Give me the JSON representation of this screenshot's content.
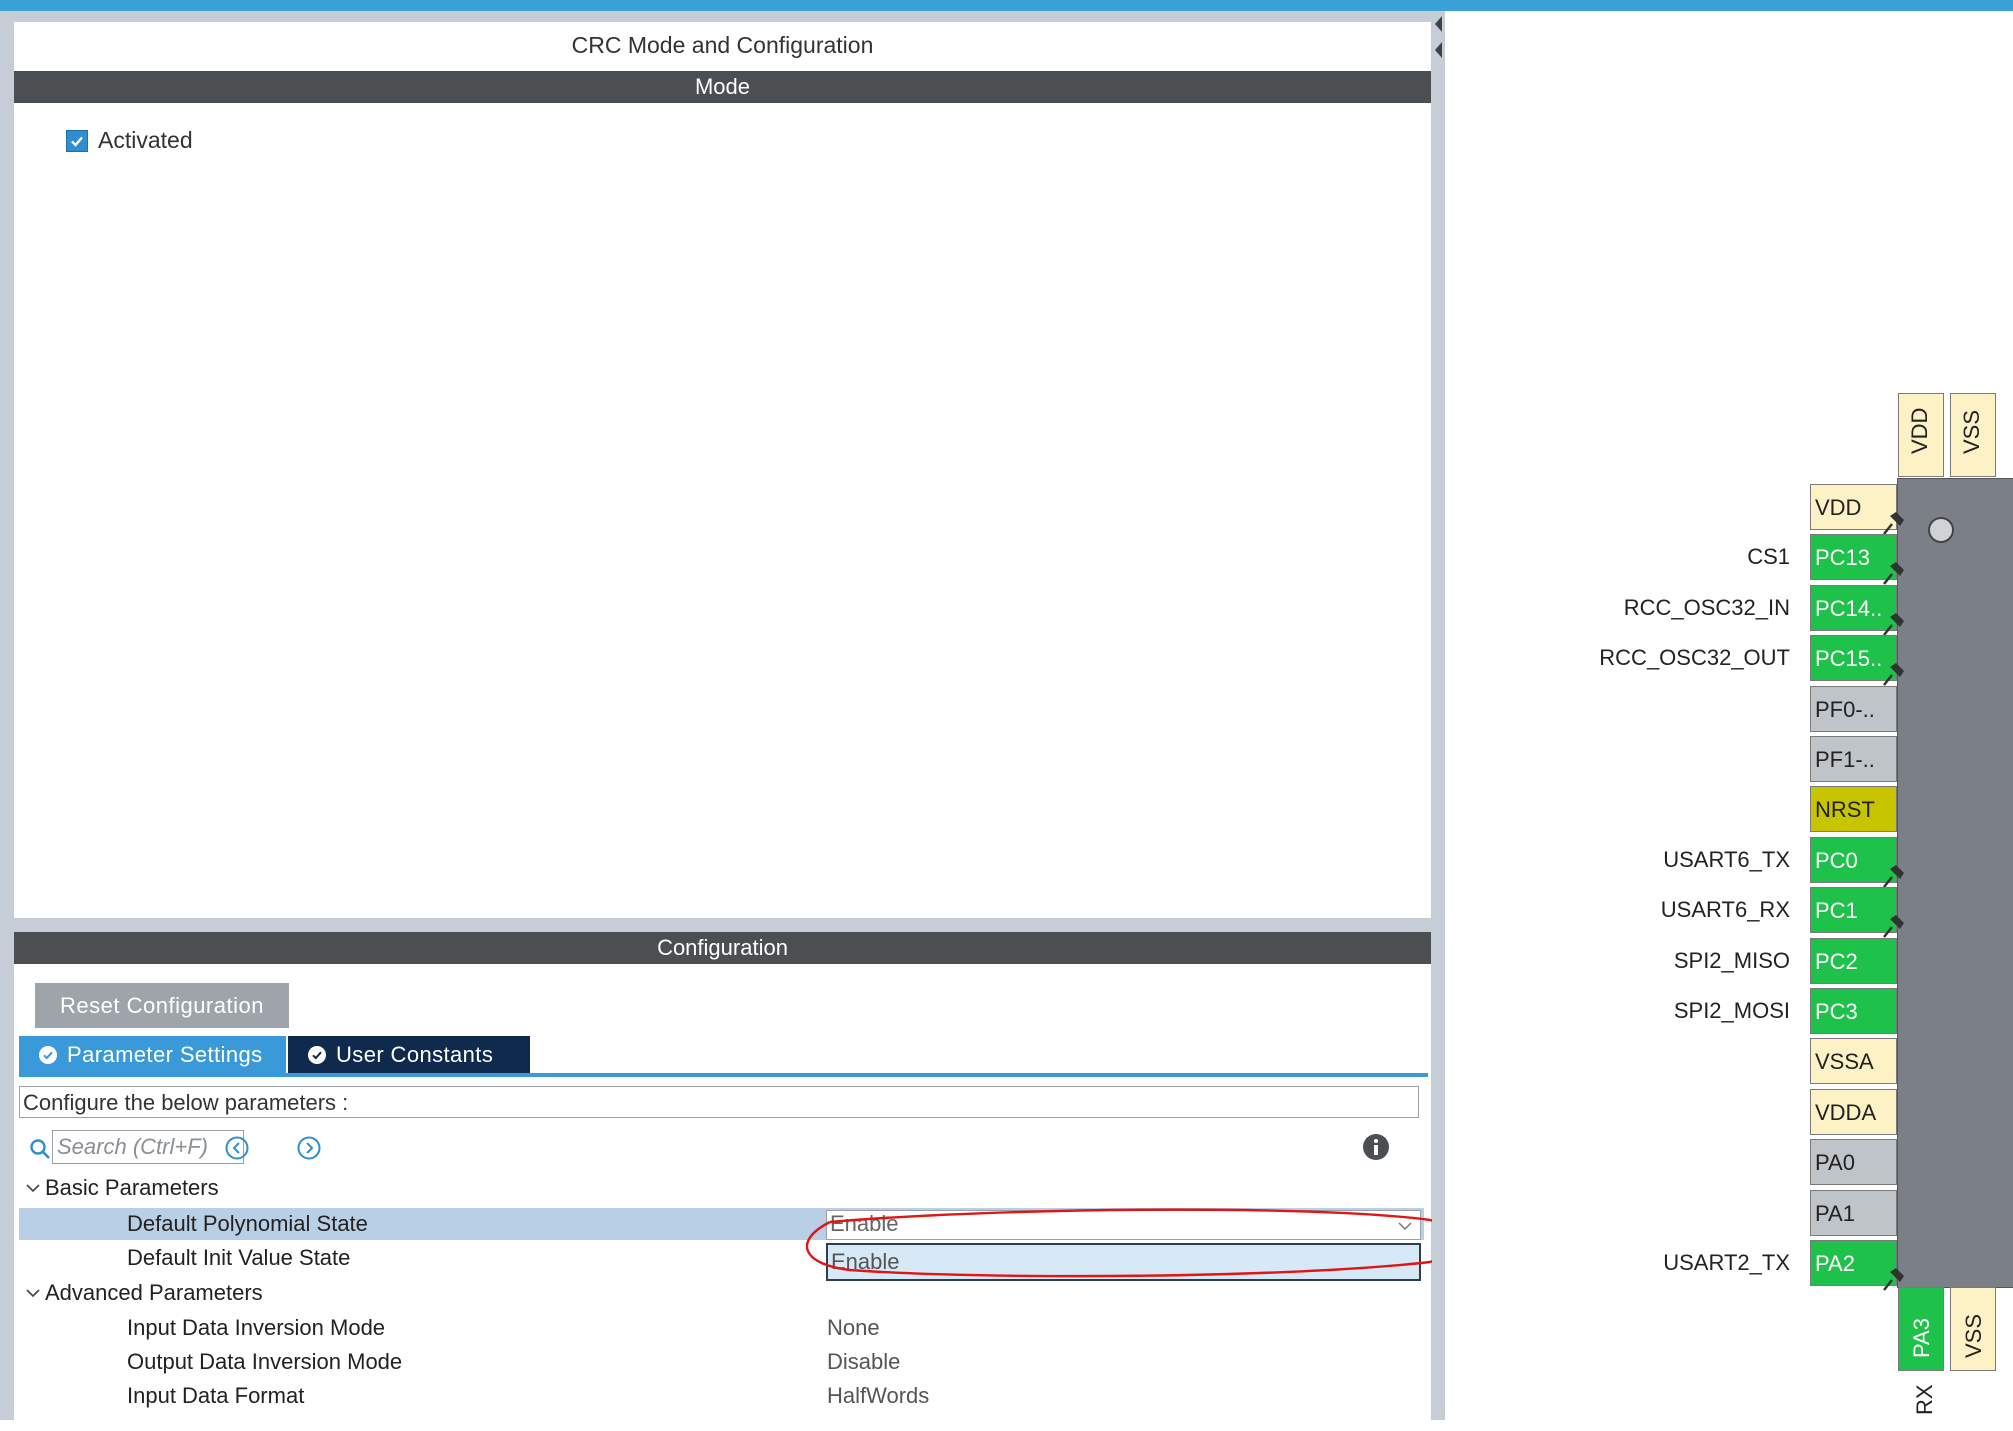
{
  "window": {
    "panel_title": "CRC Mode and Configuration",
    "accent": "#3aa0d8"
  },
  "mode": {
    "header": "Mode",
    "activated_label": "Activated",
    "activated_checked": true
  },
  "configuration": {
    "header": "Configuration",
    "reset_button": "Reset Configuration",
    "tabs": [
      {
        "label": "Parameter Settings",
        "active": true
      },
      {
        "label": "User Constants",
        "active": false
      }
    ],
    "description": "Configure the below parameters :",
    "search_placeholder": "Search (Ctrl+F)",
    "groups": [
      {
        "label": "Basic Parameters",
        "params": [
          {
            "name": "Default Polynomial State",
            "value": "Enable"
          },
          {
            "name": "Default Init Value State",
            "value": "Enable"
          }
        ]
      },
      {
        "label": "Advanced Parameters",
        "params": [
          {
            "name": "Input Data Inversion Mode",
            "value": "None"
          },
          {
            "name": "Output Data Inversion Mode",
            "value": "Disable"
          },
          {
            "name": "Input Data Format",
            "value": "HalfWords"
          }
        ]
      }
    ]
  },
  "chip": {
    "left_pins": [
      {
        "pin": "VDD",
        "label": "",
        "color": "cream"
      },
      {
        "pin": "PC13",
        "label": "CS1",
        "color": "green"
      },
      {
        "pin": "PC14..",
        "label": "RCC_OSC32_IN",
        "color": "green"
      },
      {
        "pin": "PC15..",
        "label": "RCC_OSC32_OUT",
        "color": "green"
      },
      {
        "pin": "PF0-..",
        "label": "",
        "color": "gray"
      },
      {
        "pin": "PF1-..",
        "label": "",
        "color": "gray"
      },
      {
        "pin": "NRST",
        "label": "",
        "color": "olive"
      },
      {
        "pin": "PC0",
        "label": "USART6_TX",
        "color": "green"
      },
      {
        "pin": "PC1",
        "label": "USART6_RX",
        "color": "green"
      },
      {
        "pin": "PC2",
        "label": "SPI2_MISO",
        "color": "green"
      },
      {
        "pin": "PC3",
        "label": "SPI2_MOSI",
        "color": "green"
      },
      {
        "pin": "VSSA",
        "label": "",
        "color": "cream"
      },
      {
        "pin": "VDDA",
        "label": "",
        "color": "cream"
      },
      {
        "pin": "PA0",
        "label": "",
        "color": "gray"
      },
      {
        "pin": "PA1",
        "label": "",
        "color": "gray"
      },
      {
        "pin": "PA2",
        "label": "USART2_TX",
        "color": "green"
      }
    ],
    "top_pins": [
      "VDD",
      "VSS"
    ],
    "bottom_pins": [
      {
        "pin": "PA3",
        "color": "green"
      },
      {
        "pin": "VSS",
        "color": "cream"
      }
    ],
    "bottom_label_fragment": "RX"
  }
}
